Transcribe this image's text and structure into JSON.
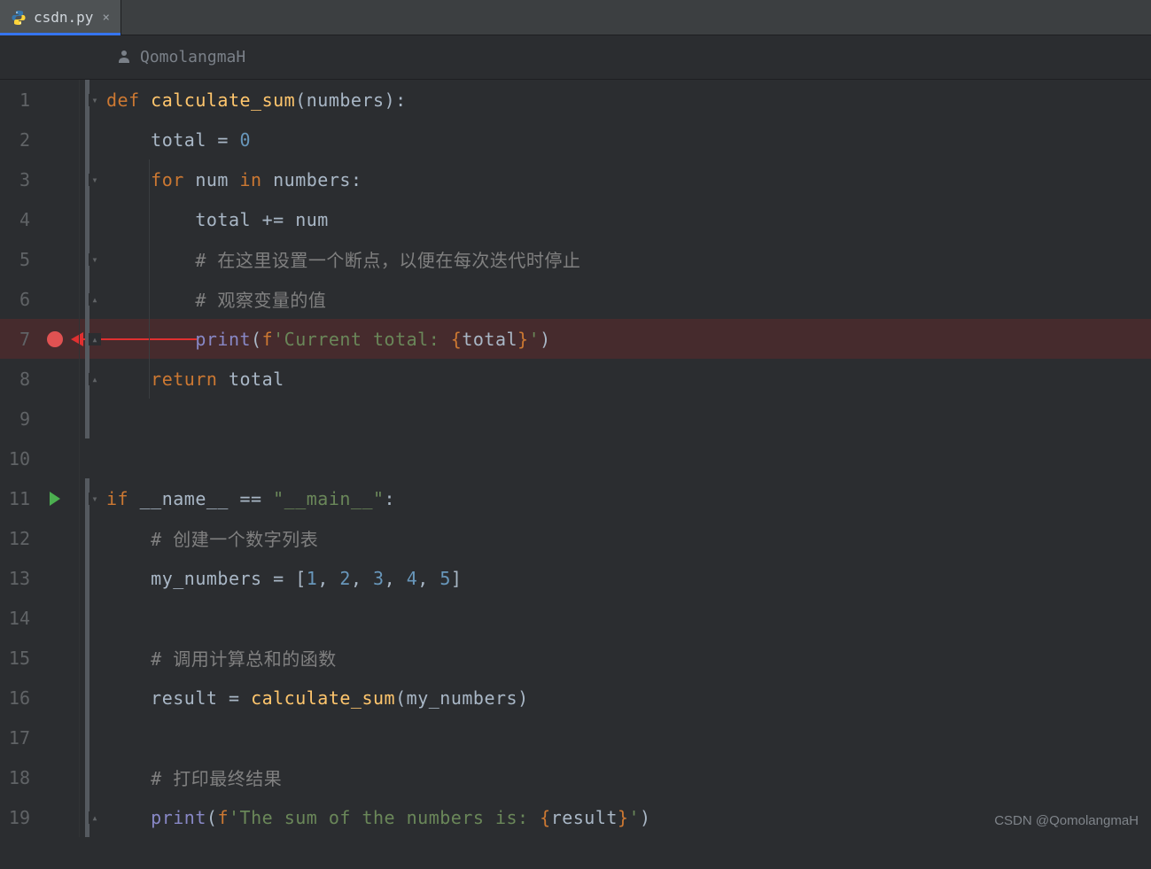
{
  "tab": {
    "filename": "csdn.py",
    "close_tooltip": "Close"
  },
  "author": "QomolangmaH",
  "watermark": "CSDN @QomolangmaH",
  "gutter": {
    "breakpoint_line": 7,
    "run_line": 11
  },
  "code": {
    "lines": [
      {
        "n": 1,
        "tokens": [
          [
            "kw",
            "def "
          ],
          [
            "fn",
            "calculate_sum"
          ],
          [
            "punct",
            "("
          ],
          [
            "param",
            "numbers"
          ],
          [
            "punct",
            "):"
          ]
        ]
      },
      {
        "n": 2,
        "indent": 1,
        "tokens": [
          [
            "ident",
            "total "
          ],
          [
            "op",
            "= "
          ],
          [
            "num",
            "0"
          ]
        ]
      },
      {
        "n": 3,
        "indent": 1,
        "tokens": [
          [
            "kw",
            "for "
          ],
          [
            "ident",
            "num "
          ],
          [
            "kw",
            "in "
          ],
          [
            "ident",
            "numbers"
          ],
          [
            "punct",
            ":"
          ]
        ]
      },
      {
        "n": 4,
        "indent": 2,
        "tokens": [
          [
            "ident",
            "total "
          ],
          [
            "op",
            "+= "
          ],
          [
            "ident",
            "num"
          ]
        ]
      },
      {
        "n": 5,
        "indent": 2,
        "tokens": [
          [
            "comm",
            "# 在这里设置一个断点，以便在每次迭代时停止"
          ]
        ]
      },
      {
        "n": 6,
        "indent": 2,
        "tokens": [
          [
            "comm",
            "# 观察变量的值"
          ]
        ]
      },
      {
        "n": 7,
        "indent": 2,
        "bp": true,
        "tokens": [
          [
            "builtin",
            "print"
          ],
          [
            "punct",
            "("
          ],
          [
            "kw",
            "f"
          ],
          [
            "str",
            "'Current total: "
          ],
          [
            "brace",
            "{"
          ],
          [
            "ident",
            "total"
          ],
          [
            "brace",
            "}"
          ],
          [
            "str",
            "'"
          ],
          [
            "punct",
            ")"
          ]
        ]
      },
      {
        "n": 8,
        "indent": 1,
        "tokens": [
          [
            "kw",
            "return "
          ],
          [
            "ident",
            "total"
          ]
        ]
      },
      {
        "n": 9,
        "tokens": []
      },
      {
        "n": 10,
        "tokens": []
      },
      {
        "n": 11,
        "run": true,
        "tokens": [
          [
            "kw",
            "if "
          ],
          [
            "ident",
            "__name__ "
          ],
          [
            "op",
            "== "
          ],
          [
            "str",
            "\"__main__\""
          ],
          [
            "punct",
            ":"
          ]
        ]
      },
      {
        "n": 12,
        "indent": 1,
        "tokens": [
          [
            "comm",
            "# 创建一个数字列表"
          ]
        ]
      },
      {
        "n": 13,
        "indent": 1,
        "tokens": [
          [
            "ident",
            "my_numbers "
          ],
          [
            "op",
            "= "
          ],
          [
            "punct",
            "["
          ],
          [
            "num",
            "1"
          ],
          [
            "punct",
            ", "
          ],
          [
            "num",
            "2"
          ],
          [
            "punct",
            ", "
          ],
          [
            "num",
            "3"
          ],
          [
            "punct",
            ", "
          ],
          [
            "num",
            "4"
          ],
          [
            "punct",
            ", "
          ],
          [
            "num",
            "5"
          ],
          [
            "punct",
            "]"
          ]
        ]
      },
      {
        "n": 14,
        "tokens": []
      },
      {
        "n": 15,
        "indent": 1,
        "tokens": [
          [
            "comm",
            "# 调用计算总和的函数"
          ]
        ]
      },
      {
        "n": 16,
        "indent": 1,
        "tokens": [
          [
            "ident",
            "result "
          ],
          [
            "op",
            "= "
          ],
          [
            "fn",
            "calculate_sum"
          ],
          [
            "punct",
            "("
          ],
          [
            "ident",
            "my_numbers"
          ],
          [
            "punct",
            ")"
          ]
        ]
      },
      {
        "n": 17,
        "tokens": []
      },
      {
        "n": 18,
        "indent": 1,
        "tokens": [
          [
            "comm",
            "# 打印最终结果"
          ]
        ]
      },
      {
        "n": 19,
        "indent": 1,
        "tokens": [
          [
            "builtin",
            "print"
          ],
          [
            "punct",
            "("
          ],
          [
            "kw",
            "f"
          ],
          [
            "str",
            "'The sum of the numbers is: "
          ],
          [
            "brace",
            "{"
          ],
          [
            "ident",
            "result"
          ],
          [
            "brace",
            "}"
          ],
          [
            "str",
            "'"
          ],
          [
            "punct",
            ")"
          ]
        ]
      }
    ]
  }
}
